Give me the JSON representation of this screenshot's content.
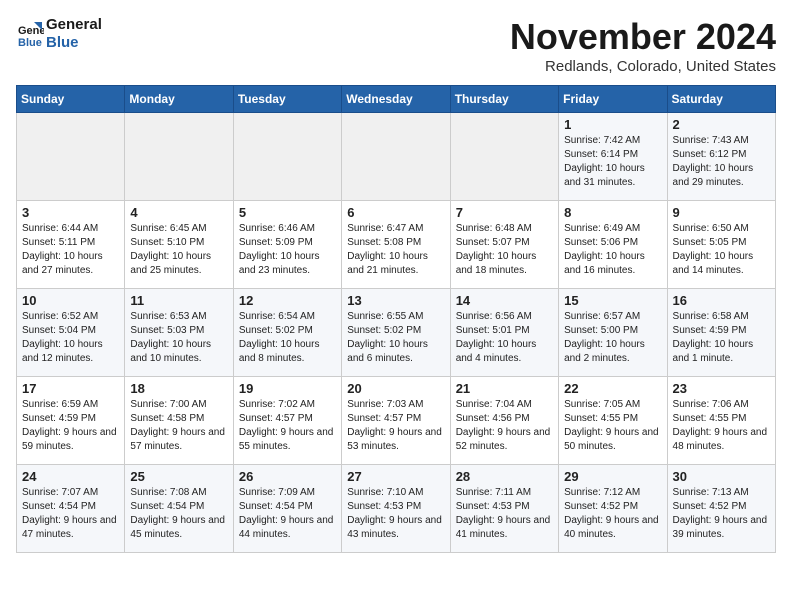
{
  "header": {
    "logo_line1": "General",
    "logo_line2": "Blue",
    "month_title": "November 2024",
    "location": "Redlands, Colorado, United States"
  },
  "days_of_week": [
    "Sunday",
    "Monday",
    "Tuesday",
    "Wednesday",
    "Thursday",
    "Friday",
    "Saturday"
  ],
  "weeks": [
    [
      {
        "day": "",
        "info": ""
      },
      {
        "day": "",
        "info": ""
      },
      {
        "day": "",
        "info": ""
      },
      {
        "day": "",
        "info": ""
      },
      {
        "day": "",
        "info": ""
      },
      {
        "day": "1",
        "info": "Sunrise: 7:42 AM\nSunset: 6:14 PM\nDaylight: 10 hours and 31 minutes."
      },
      {
        "day": "2",
        "info": "Sunrise: 7:43 AM\nSunset: 6:12 PM\nDaylight: 10 hours and 29 minutes."
      }
    ],
    [
      {
        "day": "3",
        "info": "Sunrise: 6:44 AM\nSunset: 5:11 PM\nDaylight: 10 hours and 27 minutes."
      },
      {
        "day": "4",
        "info": "Sunrise: 6:45 AM\nSunset: 5:10 PM\nDaylight: 10 hours and 25 minutes."
      },
      {
        "day": "5",
        "info": "Sunrise: 6:46 AM\nSunset: 5:09 PM\nDaylight: 10 hours and 23 minutes."
      },
      {
        "day": "6",
        "info": "Sunrise: 6:47 AM\nSunset: 5:08 PM\nDaylight: 10 hours and 21 minutes."
      },
      {
        "day": "7",
        "info": "Sunrise: 6:48 AM\nSunset: 5:07 PM\nDaylight: 10 hours and 18 minutes."
      },
      {
        "day": "8",
        "info": "Sunrise: 6:49 AM\nSunset: 5:06 PM\nDaylight: 10 hours and 16 minutes."
      },
      {
        "day": "9",
        "info": "Sunrise: 6:50 AM\nSunset: 5:05 PM\nDaylight: 10 hours and 14 minutes."
      }
    ],
    [
      {
        "day": "10",
        "info": "Sunrise: 6:52 AM\nSunset: 5:04 PM\nDaylight: 10 hours and 12 minutes."
      },
      {
        "day": "11",
        "info": "Sunrise: 6:53 AM\nSunset: 5:03 PM\nDaylight: 10 hours and 10 minutes."
      },
      {
        "day": "12",
        "info": "Sunrise: 6:54 AM\nSunset: 5:02 PM\nDaylight: 10 hours and 8 minutes."
      },
      {
        "day": "13",
        "info": "Sunrise: 6:55 AM\nSunset: 5:02 PM\nDaylight: 10 hours and 6 minutes."
      },
      {
        "day": "14",
        "info": "Sunrise: 6:56 AM\nSunset: 5:01 PM\nDaylight: 10 hours and 4 minutes."
      },
      {
        "day": "15",
        "info": "Sunrise: 6:57 AM\nSunset: 5:00 PM\nDaylight: 10 hours and 2 minutes."
      },
      {
        "day": "16",
        "info": "Sunrise: 6:58 AM\nSunset: 4:59 PM\nDaylight: 10 hours and 1 minute."
      }
    ],
    [
      {
        "day": "17",
        "info": "Sunrise: 6:59 AM\nSunset: 4:59 PM\nDaylight: 9 hours and 59 minutes."
      },
      {
        "day": "18",
        "info": "Sunrise: 7:00 AM\nSunset: 4:58 PM\nDaylight: 9 hours and 57 minutes."
      },
      {
        "day": "19",
        "info": "Sunrise: 7:02 AM\nSunset: 4:57 PM\nDaylight: 9 hours and 55 minutes."
      },
      {
        "day": "20",
        "info": "Sunrise: 7:03 AM\nSunset: 4:57 PM\nDaylight: 9 hours and 53 minutes."
      },
      {
        "day": "21",
        "info": "Sunrise: 7:04 AM\nSunset: 4:56 PM\nDaylight: 9 hours and 52 minutes."
      },
      {
        "day": "22",
        "info": "Sunrise: 7:05 AM\nSunset: 4:55 PM\nDaylight: 9 hours and 50 minutes."
      },
      {
        "day": "23",
        "info": "Sunrise: 7:06 AM\nSunset: 4:55 PM\nDaylight: 9 hours and 48 minutes."
      }
    ],
    [
      {
        "day": "24",
        "info": "Sunrise: 7:07 AM\nSunset: 4:54 PM\nDaylight: 9 hours and 47 minutes."
      },
      {
        "day": "25",
        "info": "Sunrise: 7:08 AM\nSunset: 4:54 PM\nDaylight: 9 hours and 45 minutes."
      },
      {
        "day": "26",
        "info": "Sunrise: 7:09 AM\nSunset: 4:54 PM\nDaylight: 9 hours and 44 minutes."
      },
      {
        "day": "27",
        "info": "Sunrise: 7:10 AM\nSunset: 4:53 PM\nDaylight: 9 hours and 43 minutes."
      },
      {
        "day": "28",
        "info": "Sunrise: 7:11 AM\nSunset: 4:53 PM\nDaylight: 9 hours and 41 minutes."
      },
      {
        "day": "29",
        "info": "Sunrise: 7:12 AM\nSunset: 4:52 PM\nDaylight: 9 hours and 40 minutes."
      },
      {
        "day": "30",
        "info": "Sunrise: 7:13 AM\nSunset: 4:52 PM\nDaylight: 9 hours and 39 minutes."
      }
    ]
  ]
}
